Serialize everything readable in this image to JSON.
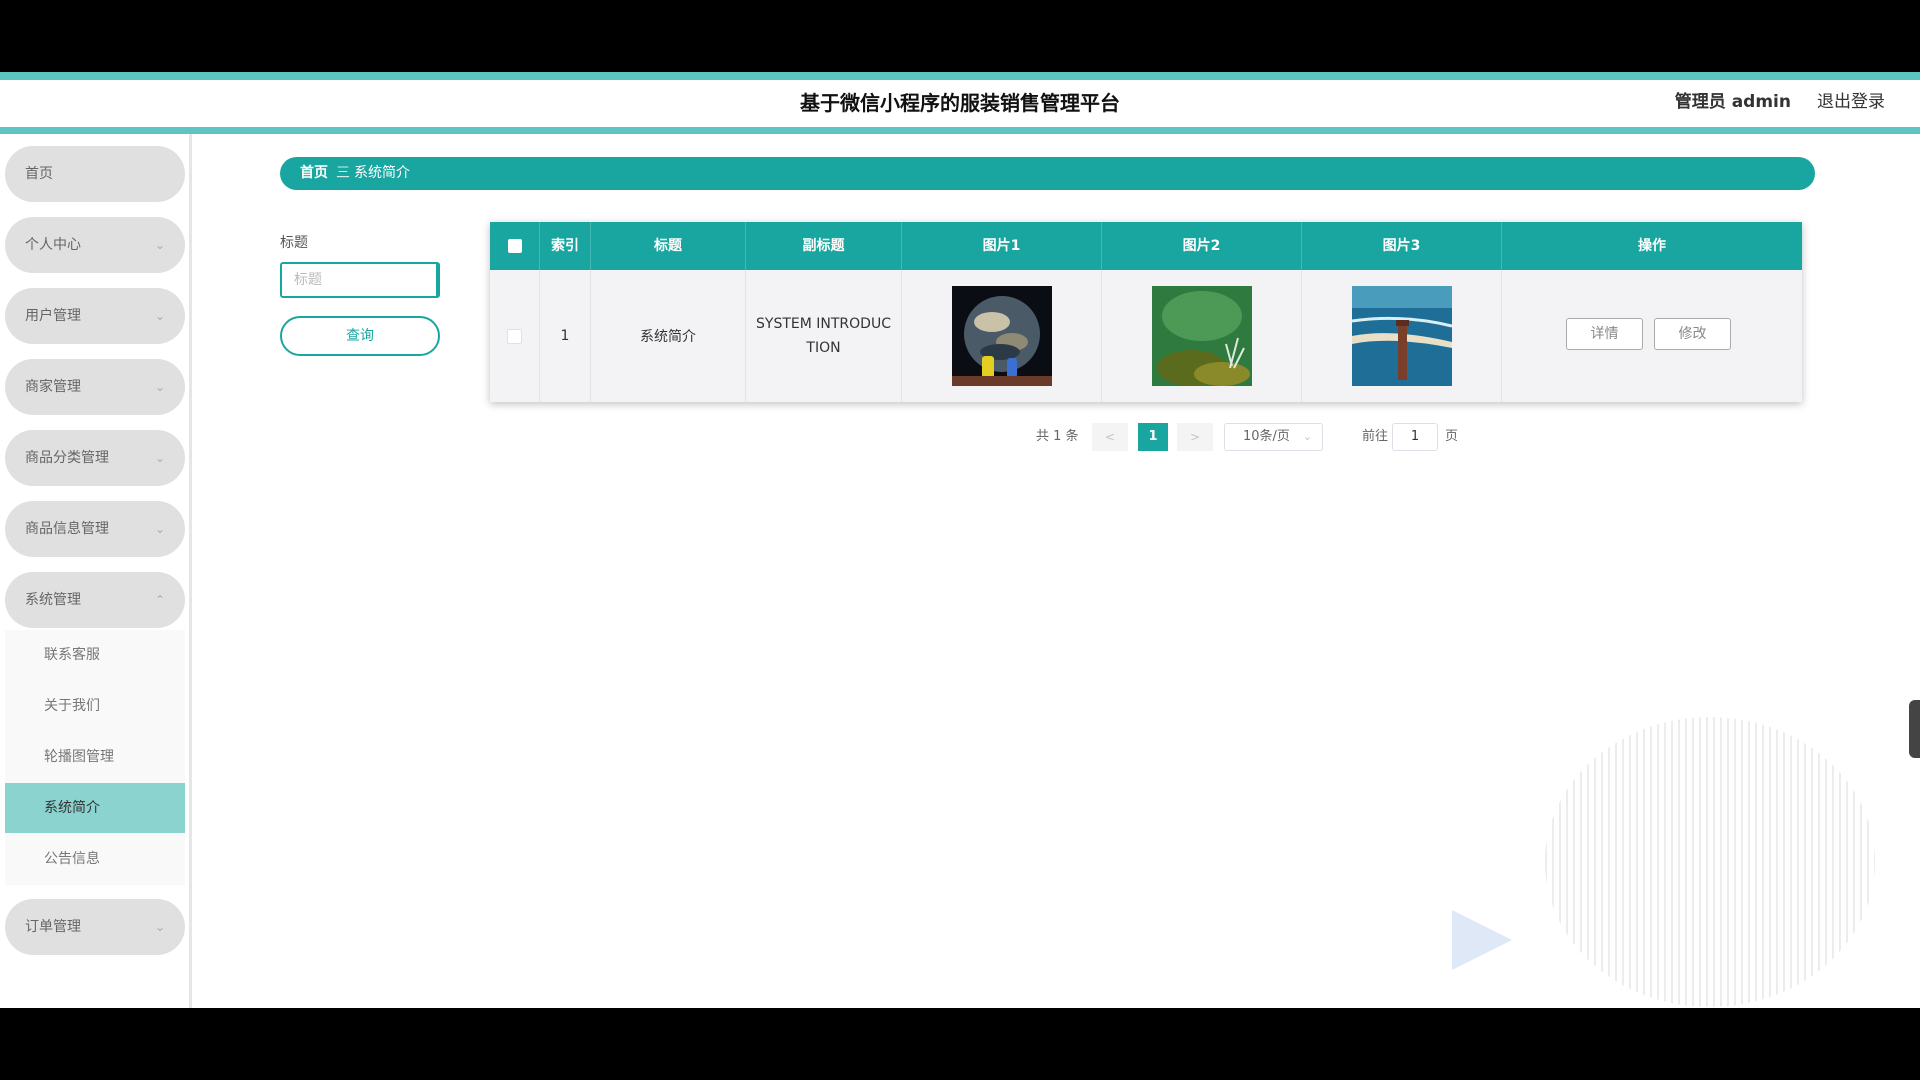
{
  "header": {
    "title": "基于微信小程序的服装销售管理平台",
    "user_role": "管理员",
    "user_name": "admin",
    "logout": "退出登录"
  },
  "sidebar": {
    "items": [
      {
        "label": "首页"
      },
      {
        "label": "个人中心"
      },
      {
        "label": "用户管理"
      },
      {
        "label": "商家管理"
      },
      {
        "label": "商品分类管理"
      },
      {
        "label": "商品信息管理"
      },
      {
        "label": "系统管理"
      },
      {
        "label": "订单管理"
      }
    ],
    "submenu": [
      {
        "label": "联系客服"
      },
      {
        "label": "关于我们"
      },
      {
        "label": "轮播图管理"
      },
      {
        "label": "系统简介"
      },
      {
        "label": "公告信息"
      }
    ],
    "active_submenu": "系统简介"
  },
  "breadcrumb": {
    "home": "首页",
    "separator": "三",
    "current": "系统简介"
  },
  "filter": {
    "label": "标题",
    "placeholder": "标题",
    "search_button": "查询"
  },
  "table": {
    "headers": [
      "索引",
      "标题",
      "副标题",
      "图片1",
      "图片2",
      "图片3",
      "操作"
    ],
    "rows": [
      {
        "index": "1",
        "title": "系统简介",
        "subtitle": "SYSTEM INTRODUCTION",
        "actions": {
          "detail": "详情",
          "edit": "修改"
        }
      }
    ]
  },
  "pagination": {
    "total": "共 1 条",
    "prev": "<",
    "current": "1",
    "next": ">",
    "page_size": "10条/页",
    "goto_label": "前往",
    "goto_value": "1",
    "page_unit": "页"
  },
  "colors": {
    "accent": "#1aa6a0",
    "accent_light": "#5ec4c1",
    "active_submenu": "#8bd3cf",
    "sidebar_item": "#e0e0e0"
  }
}
